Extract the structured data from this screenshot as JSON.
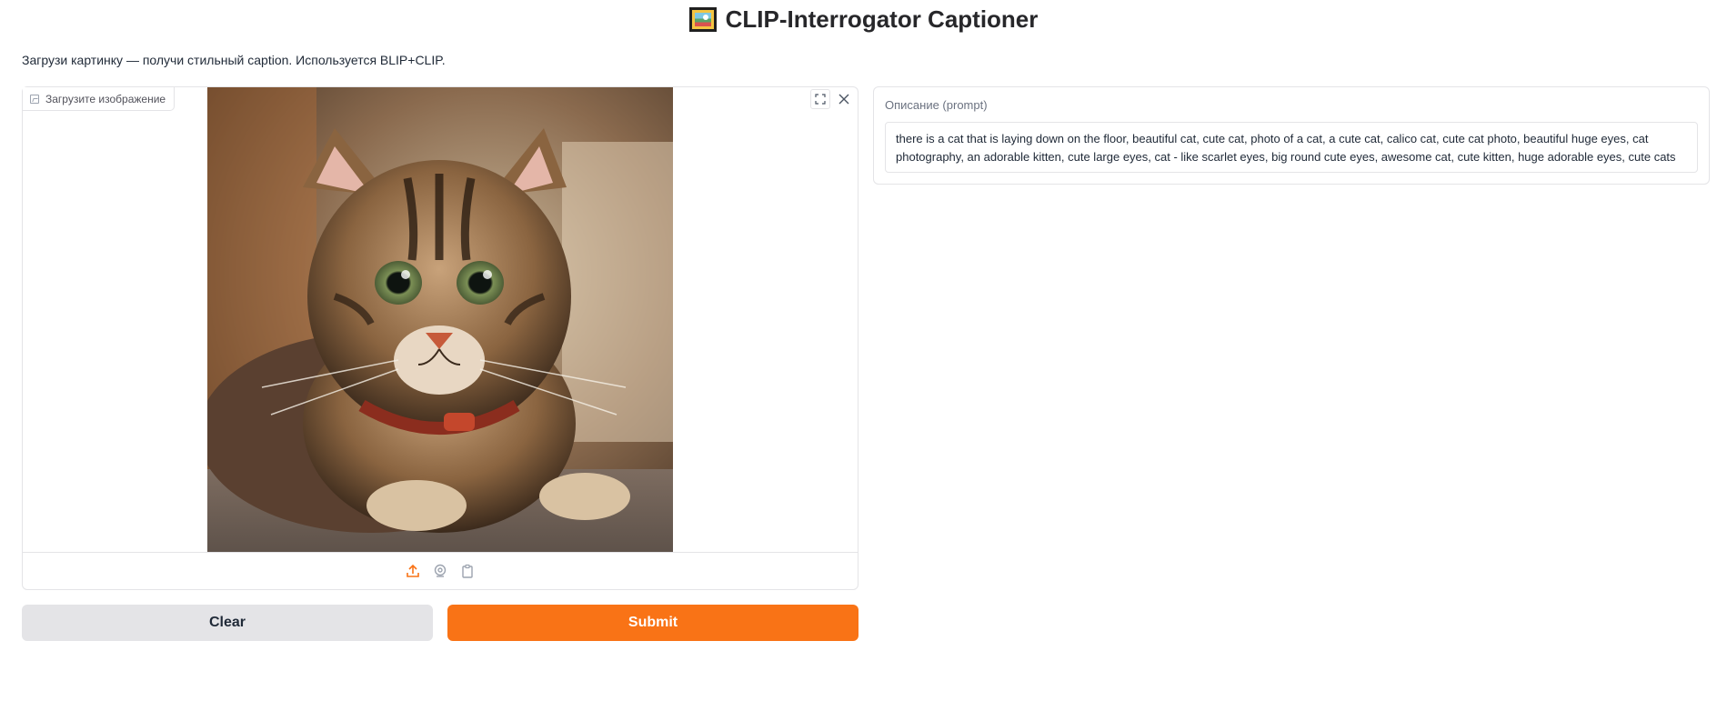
{
  "header": {
    "title": "CLIP-Interrogator Captioner",
    "title_emoji": "framed-picture-icon",
    "subtitle": "Загрузи картинку — получи стильный caption. Используется BLIP+CLIP."
  },
  "image_input": {
    "label": "Загрузите изображение",
    "image_subject": "tabby cat lying on floor with red collar",
    "buttons": [
      "fullscreen-icon",
      "close-icon"
    ],
    "sources": [
      "upload-icon",
      "webcam-icon",
      "clipboard-icon"
    ]
  },
  "actions": {
    "clear_label": "Clear",
    "submit_label": "Submit"
  },
  "output": {
    "label": "Описание (prompt)",
    "value": "there is a cat that is laying down on the floor, beautiful cat, cute cat, photo of a cat, a cute cat, calico cat, cute cat photo, beautiful huge eyes, cat photography, an adorable kitten, cute large eyes, cat - like scarlet eyes, big round cute eyes, awesome cat, cute kitten, huge adorable eyes, cute cats"
  },
  "colors": {
    "accent": "#f97316",
    "secondary_button": "#e4e4e7",
    "border": "#e4e4e7"
  }
}
